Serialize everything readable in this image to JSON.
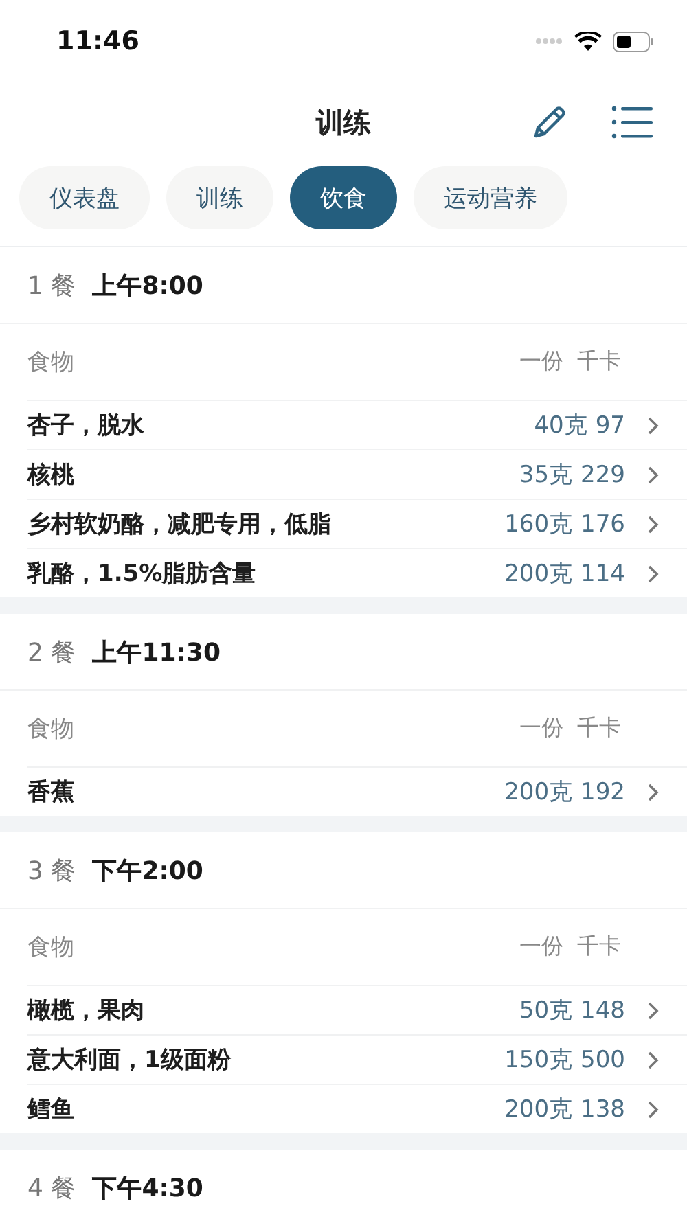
{
  "status_bar": {
    "time": "11:46"
  },
  "header": {
    "title": "训练"
  },
  "tabs": [
    {
      "label": "仪表盘",
      "selected": false
    },
    {
      "label": "训练",
      "selected": false
    },
    {
      "label": "饮食",
      "selected": true
    },
    {
      "label": "运动营养",
      "selected": false
    }
  ],
  "meals": [
    {
      "number": "1 餐",
      "time": "上午8:00",
      "columns": {
        "food": "食物",
        "serving": "一份",
        "kcal": "千卡"
      },
      "items": [
        {
          "name": "杏子，脱水",
          "serving": "40克",
          "kcal": "97"
        },
        {
          "name": "核桃",
          "serving": "35克",
          "kcal": "229"
        },
        {
          "name": "乡村软奶酪，减肥专用，低脂",
          "serving": "160克",
          "kcal": "176"
        },
        {
          "name": "乳酪，1.5%脂肪含量",
          "serving": "200克",
          "kcal": "114"
        }
      ]
    },
    {
      "number": "2 餐",
      "time": "上午11:30",
      "columns": {
        "food": "食物",
        "serving": "一份",
        "kcal": "千卡"
      },
      "items": [
        {
          "name": "香蕉",
          "serving": "200克",
          "kcal": "192"
        }
      ]
    },
    {
      "number": "3 餐",
      "time": "下午2:00",
      "columns": {
        "food": "食物",
        "serving": "一份",
        "kcal": "千卡"
      },
      "items": [
        {
          "name": "橄榄，果肉",
          "serving": "50克",
          "kcal": "148"
        },
        {
          "name": "意大利面，1级面粉",
          "serving": "150克",
          "kcal": "500"
        },
        {
          "name": "鳕鱼",
          "serving": "200克",
          "kcal": "138"
        }
      ]
    },
    {
      "number": "4 餐",
      "time": "下午4:30"
    }
  ]
}
